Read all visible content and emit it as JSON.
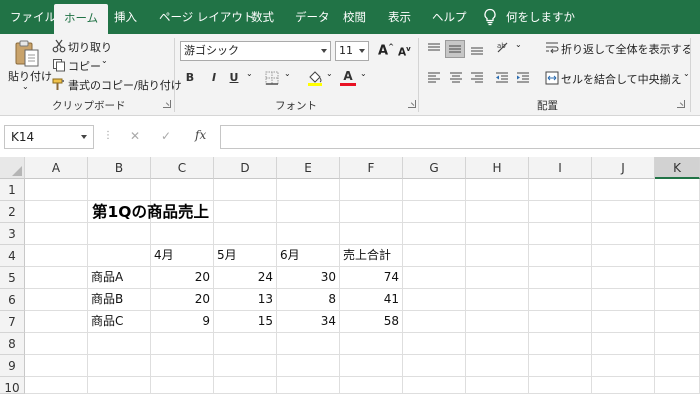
{
  "tabs": [
    {
      "label": "ファイル",
      "active": false
    },
    {
      "label": "ホーム",
      "active": true
    },
    {
      "label": "挿入",
      "active": false
    },
    {
      "label": "ページ レイアウト",
      "active": false
    },
    {
      "label": "数式",
      "active": false
    },
    {
      "label": "データ",
      "active": false
    },
    {
      "label": "校閲",
      "active": false
    },
    {
      "label": "表示",
      "active": false
    },
    {
      "label": "ヘルプ",
      "active": false
    }
  ],
  "tell_me": "何をしますか",
  "clipboard": {
    "paste": "貼り付け",
    "cut": "切り取り",
    "copy": "コピー",
    "format_painter": "書式のコピー/貼り付け",
    "group": "クリップボード"
  },
  "font": {
    "name": "游ゴシック",
    "size": "11",
    "grow": "A",
    "shrink": "A",
    "bold": "B",
    "italic": "I",
    "underline": "U",
    "color_letter": "A",
    "group": "フォント"
  },
  "alignment": {
    "wrap": "折り返して全体を表示する",
    "merge": "セルを結合して中央揃え",
    "group": "配置"
  },
  "formula_bar": {
    "name_box": "K14",
    "cancel": "✕",
    "enter": "✓",
    "fx": "fx",
    "content": ""
  },
  "colors": {
    "accent": "#217346",
    "font_color": "#e81123",
    "highlight": "#ffff00"
  },
  "columns": [
    "A",
    "B",
    "C",
    "D",
    "E",
    "F",
    "G",
    "H",
    "I",
    "J",
    "K"
  ],
  "rows": [
    "1",
    "2",
    "3",
    "4",
    "5",
    "6",
    "7",
    "8",
    "9",
    "10"
  ],
  "sheet": {
    "title": "第1Qの商品売上",
    "headers": [
      "4月",
      "5月",
      "6月",
      "売上合計"
    ],
    "data": [
      {
        "name": "商品A",
        "values": [
          "20",
          "24",
          "30",
          "74"
        ]
      },
      {
        "name": "商品B",
        "values": [
          "20",
          "13",
          "8",
          "41"
        ]
      },
      {
        "name": "商品C",
        "values": [
          "9",
          "15",
          "34",
          "58"
        ]
      }
    ]
  }
}
